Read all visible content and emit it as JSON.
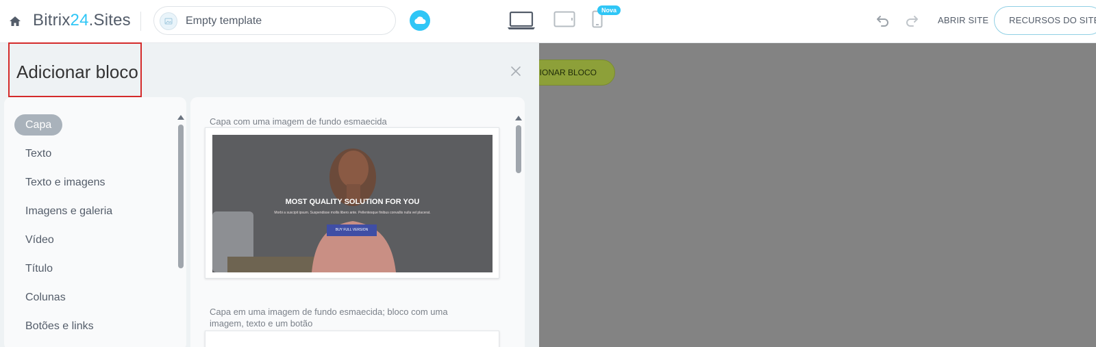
{
  "header": {
    "brand_prefix": "Bitrix",
    "brand_number": "24",
    "brand_suffix": ".Sites",
    "template_name": "Empty template",
    "new_badge": "Nova",
    "open_site": "ABRIR SITE",
    "site_resources": "RECURSOS DO SITE",
    "accent_color": "#2fc6f6"
  },
  "page": {
    "add_block_button": "CIONAR BLOCO"
  },
  "panel": {
    "title": "Adicionar bloco",
    "categories": [
      {
        "label": "Capa",
        "active": true
      },
      {
        "label": "Texto",
        "active": false
      },
      {
        "label": "Texto e imagens",
        "active": false
      },
      {
        "label": "Imagens e galeria",
        "active": false
      },
      {
        "label": "Vídeo",
        "active": false
      },
      {
        "label": "Título",
        "active": false
      },
      {
        "label": "Colunas",
        "active": false
      },
      {
        "label": "Botões e links",
        "active": false
      }
    ],
    "blocks": [
      {
        "caption": "Capa com uma imagem de fundo esmaecida",
        "preview_headline": "MOST QUALITY SOLUTION FOR YOU",
        "preview_subtext": "Morbi a suscipit ipsum. Suspendisse mollis libero ante. Pellentesque finibus convallis nulla vel placerat.",
        "preview_button": "BUY FULL VERSION"
      },
      {
        "caption_line1": "Capa em uma imagem de fundo esmaecida; bloco com uma",
        "caption_line2": "imagem, texto e um botão"
      }
    ]
  },
  "icons": {
    "home": "home-icon",
    "cloud": "cloud-icon",
    "desktop": "desktop-icon",
    "tablet": "tablet-icon",
    "phone": "phone-icon",
    "undo": "undo-icon",
    "redo": "redo-icon",
    "close": "close-icon"
  }
}
